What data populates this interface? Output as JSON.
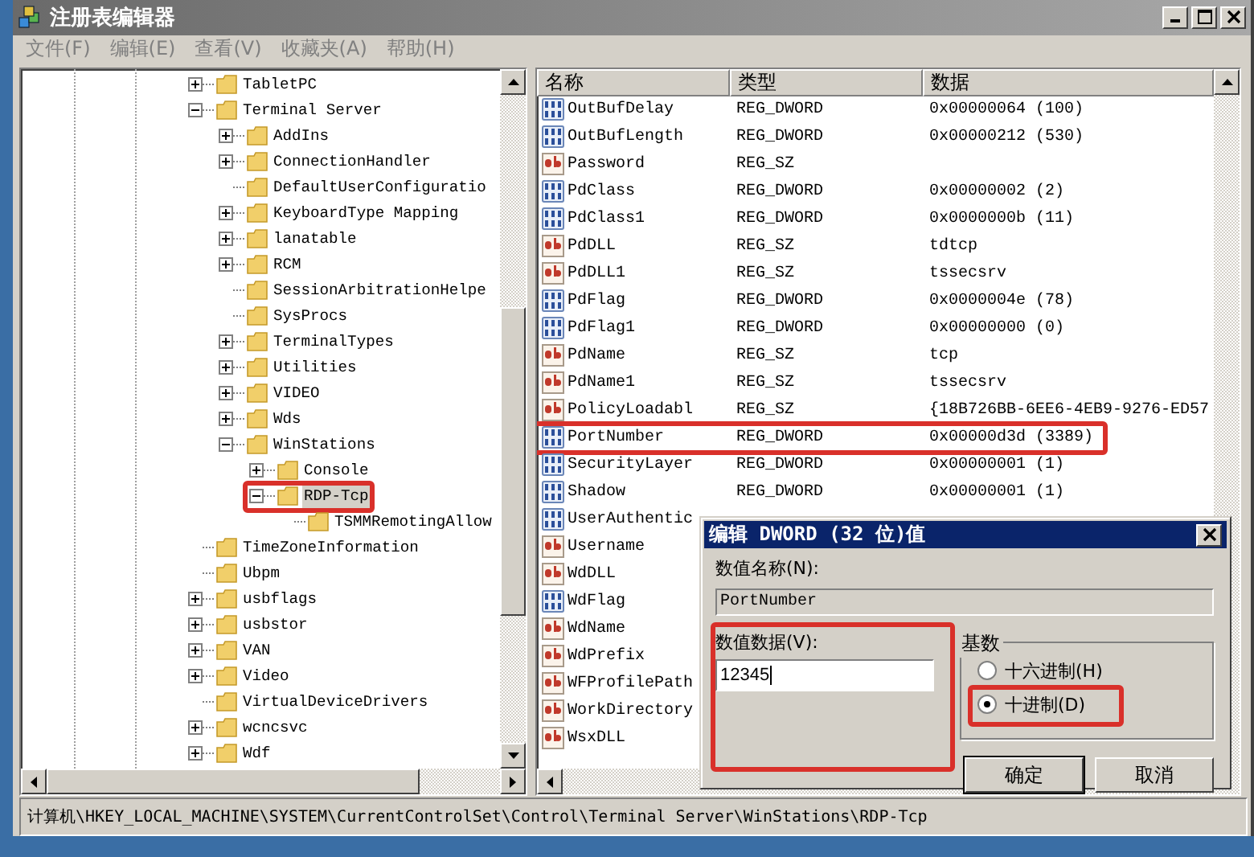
{
  "window": {
    "title": "注册表编辑器"
  },
  "menu": [
    {
      "label": "文件(F)",
      "disabled": true
    },
    {
      "label": "编辑(E)",
      "disabled": true
    },
    {
      "label": "查看(V)",
      "disabled": true
    },
    {
      "label": "收藏夹(A)",
      "disabled": true
    },
    {
      "label": "帮助(H)",
      "disabled": true
    }
  ],
  "tree": [
    {
      "name": "TabletPC",
      "expanded": false,
      "selected": false,
      "highlighted": false
    },
    {
      "name": "Terminal Server",
      "expanded": true,
      "selected": false,
      "highlighted": false,
      "children": [
        {
          "name": "AddIns",
          "expanded": false,
          "selected": false,
          "highlighted": false
        },
        {
          "name": "ConnectionHandler",
          "expanded": false,
          "selected": false,
          "highlighted": false
        },
        {
          "name": "DefaultUserConfiguratio",
          "selected": false,
          "highlighted": false
        },
        {
          "name": "KeyboardType Mapping",
          "expanded": false,
          "selected": false,
          "highlighted": false
        },
        {
          "name": "lanatable",
          "expanded": false,
          "selected": false,
          "highlighted": false
        },
        {
          "name": "RCM",
          "expanded": false,
          "selected": false,
          "highlighted": false
        },
        {
          "name": "SessionArbitrationHelpe",
          "selected": false,
          "highlighted": false
        },
        {
          "name": "SysProcs",
          "selected": false,
          "highlighted": false
        },
        {
          "name": "TerminalTypes",
          "expanded": false,
          "selected": false,
          "highlighted": false
        },
        {
          "name": "Utilities",
          "expanded": false,
          "selected": false,
          "highlighted": false
        },
        {
          "name": "VIDEO",
          "expanded": false,
          "selected": false,
          "highlighted": false
        },
        {
          "name": "Wds",
          "expanded": false,
          "selected": false,
          "highlighted": false
        },
        {
          "name": "WinStations",
          "expanded": true,
          "selected": false,
          "highlighted": false,
          "children": [
            {
              "name": "Console",
              "expanded": false,
              "selected": false,
              "highlighted": false
            },
            {
              "name": "RDP-Tcp",
              "expanded": true,
              "selected": true,
              "highlighted": true,
              "children": [
                {
                  "name": "TSMMRemotingAllow",
                  "selected": false,
                  "highlighted": false
                }
              ]
            }
          ]
        }
      ]
    },
    {
      "name": "TimeZoneInformation",
      "selected": false,
      "highlighted": false
    },
    {
      "name": "Ubpm",
      "selected": false,
      "highlighted": false
    },
    {
      "name": "usbflags",
      "expanded": false,
      "selected": false,
      "highlighted": false
    },
    {
      "name": "usbstor",
      "expanded": false,
      "selected": false,
      "highlighted": false
    },
    {
      "name": "VAN",
      "expanded": false,
      "selected": false,
      "highlighted": false
    },
    {
      "name": "Video",
      "expanded": false,
      "selected": false,
      "highlighted": false
    },
    {
      "name": "VirtualDeviceDrivers",
      "selected": false,
      "highlighted": false
    },
    {
      "name": "wcncsvc",
      "expanded": false,
      "selected": false,
      "highlighted": false
    },
    {
      "name": "Wdf",
      "expanded": false,
      "selected": false,
      "highlighted": false
    }
  ],
  "values": {
    "columns": [
      "名称",
      "类型",
      "数据"
    ],
    "rows": [
      {
        "kind": "dword",
        "name": "OutBufDelay",
        "type": "REG_DWORD",
        "data": "0x00000064 (100)",
        "highlighted": false
      },
      {
        "kind": "dword",
        "name": "OutBufLength",
        "type": "REG_DWORD",
        "data": "0x00000212 (530)",
        "highlighted": false
      },
      {
        "kind": "sz",
        "name": "Password",
        "type": "REG_SZ",
        "highlighted": false
      },
      {
        "kind": "dword",
        "name": "PdClass",
        "type": "REG_DWORD",
        "data": "0x00000002 (2)",
        "highlighted": false
      },
      {
        "kind": "dword",
        "name": "PdClass1",
        "type": "REG_DWORD",
        "data": "0x0000000b (11)",
        "highlighted": false
      },
      {
        "kind": "sz",
        "name": "PdDLL",
        "type": "REG_SZ",
        "data": "tdtcp",
        "highlighted": false
      },
      {
        "kind": "sz",
        "name": "PdDLL1",
        "type": "REG_SZ",
        "data": "tssecsrv",
        "highlighted": false
      },
      {
        "kind": "dword",
        "name": "PdFlag",
        "type": "REG_DWORD",
        "data": "0x0000004e (78)",
        "highlighted": false
      },
      {
        "kind": "dword",
        "name": "PdFlag1",
        "type": "REG_DWORD",
        "data": "0x00000000 (0)",
        "highlighted": false
      },
      {
        "kind": "sz",
        "name": "PdName",
        "type": "REG_SZ",
        "data": "tcp",
        "highlighted": false
      },
      {
        "kind": "sz",
        "name": "PdName1",
        "type": "REG_SZ",
        "data": "tssecsrv",
        "highlighted": false
      },
      {
        "kind": "sz",
        "name": "PolicyLoadabl",
        "type": "REG_SZ",
        "data": "{18B726BB-6EE6-4EB9-9276-ED57",
        "highlighted": false
      },
      {
        "kind": "dword",
        "name": "PortNumber",
        "type": "REG_DWORD",
        "data": "0x00000d3d (3389)",
        "highlighted": true
      },
      {
        "kind": "dword",
        "name": "SecurityLayer",
        "type": "REG_DWORD",
        "data": "0x00000001 (1)",
        "highlighted": false
      },
      {
        "kind": "dword",
        "name": "Shadow",
        "type": "REG_DWORD",
        "data": "0x00000001 (1)",
        "highlighted": false
      },
      {
        "kind": "dword",
        "name": "UserAuthentic",
        "highlighted": false
      },
      {
        "kind": "sz",
        "name": "Username",
        "highlighted": false
      },
      {
        "kind": "sz",
        "name": "WdDLL",
        "highlighted": false
      },
      {
        "kind": "dword",
        "name": "WdFlag",
        "highlighted": false
      },
      {
        "kind": "sz",
        "name": "WdName",
        "highlighted": false
      },
      {
        "kind": "sz",
        "name": "WdPrefix",
        "highlighted": false
      },
      {
        "kind": "sz",
        "name": "WFProfilePath",
        "highlighted": false
      },
      {
        "kind": "sz",
        "name": "WorkDirectory",
        "highlighted": false
      },
      {
        "kind": "sz",
        "name": "WsxDLL",
        "highlighted": false
      }
    ]
  },
  "status_bar": "计算机\\HKEY_LOCAL_MACHINE\\SYSTEM\\CurrentControlSet\\Control\\Terminal Server\\WinStations\\RDP-Tcp",
  "dialog": {
    "title": "编辑 DWORD (32 位)值",
    "value_name": {
      "label": "数值名称(N):",
      "value": "PortNumber"
    },
    "value_data": {
      "label": "数值数据(V):",
      "value": "12345",
      "highlighted": true
    },
    "base": {
      "label": "基数",
      "options": [
        {
          "label": "十六进制(H)",
          "selected": false,
          "highlighted": false
        },
        {
          "label": "十进制(D)",
          "selected": true,
          "highlighted": true
        }
      ]
    },
    "buttons": [
      {
        "label": "确定",
        "default": true
      },
      {
        "label": "取消",
        "default": false
      }
    ]
  }
}
